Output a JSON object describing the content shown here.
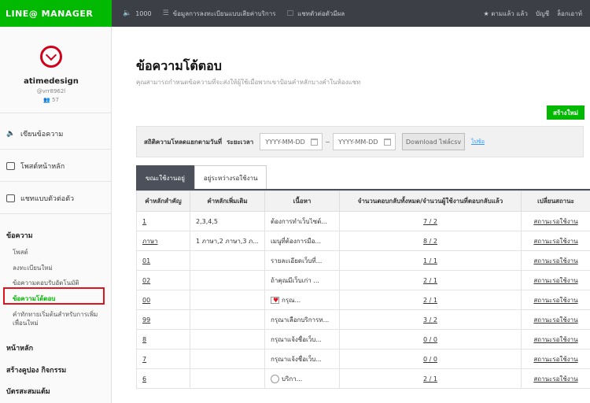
{
  "app": {
    "logo": "LINE@ MANAGER"
  },
  "topbar": {
    "item1": "1000",
    "item2": "ข้อมูลการลงทะเบียนแบบเสียค่าบริการ",
    "item3": "แชทตัวต่อตัวมีผล",
    "right1": "★ ตามแล้ว แล้ว",
    "right2": "บัญชี",
    "right3": "ล็อกเอาท์"
  },
  "account": {
    "name": "atimedesign",
    "id": "@vrr8962l",
    "friends": "57"
  },
  "sidebar": {
    "nav": [
      "เขียนข้อความ",
      "โพสต์หน้าหลัก",
      "แชทแบบตัวต่อตัว"
    ],
    "section_message": "ข้อความ",
    "sub_items": [
      "โพสต์",
      "ลงทะเบียนใหม่",
      "ข้อความตอบรับอัตโนมัติ",
      "ข้อความโต้ตอบ",
      "คำทักทายเริ่มต้นสำหรับการเพิ่ม",
      "เพื่อนใหม่"
    ],
    "section_home": "หน้าหลัก",
    "section_coupon": "สร้างคูปอง กิจกรรม",
    "section_card": "บัตรสะสมแต้ม"
  },
  "main": {
    "title": "ข้อความโต้ตอบ",
    "description": "คุณสามารถกำหนดข้อความที่จะส่งให้ผู้ใช้เมื่อพวกเขาป้อนคำหลักบางคำในห้องแชท",
    "create_button": "สร้างใหม่",
    "filter_label": "สถิติความโหลดแยกตามวันที่",
    "period_label": "ระยะเวลา",
    "date_placeholder_start": "YYYY-MM-DD",
    "date_placeholder_end": "YYYY-MM-DD",
    "tilde": "~",
    "download_button": "Download ไฟล์csv",
    "help_link": "ไปซ้อ",
    "tabs": [
      "ขณะใช้งานอยู่",
      "อยู่ระหว่างรอใช้งาน"
    ]
  },
  "table": {
    "headers": [
      "คำหลักสำคัญ",
      "คำหลักเพิ่มเติม",
      "เนื้อหา",
      "จำนวนตอบกลับทั้งหมด/จำนวนผู้ใช้งานที่ตอบกลับแล้ว",
      "เปลี่ยนสถานะ"
    ],
    "rows": [
      {
        "keyword": "1",
        "extra": "2,3,4,5",
        "content": "ต้องการทำเว็บไซต์...",
        "count": "7 / 2",
        "status": "สถานะรอใช้งาน",
        "emoji": ""
      },
      {
        "keyword": "ภาษา",
        "extra": "1 ภาษา,2 ภาษา,3 ภ...",
        "content": "เมนูที่ต้องการมือ...",
        "count": "8 / 2",
        "status": "สถานะรอใช้งาน",
        "emoji": ""
      },
      {
        "keyword": "01",
        "extra": "",
        "content": "รายละเอียดเว็บที่...",
        "count": "1 / 1",
        "status": "สถานะรอใช้งาน",
        "emoji": ""
      },
      {
        "keyword": "02",
        "extra": "",
        "content": "ถ้าคุณมีเว็บเก่า ...",
        "count": "2 / 1",
        "status": "สถานะรอใช้งาน",
        "emoji": ""
      },
      {
        "keyword": "00",
        "extra": "",
        "content": "กรุณ...",
        "count": "2 / 1",
        "status": "สถานะรอใช้งาน",
        "emoji": "heart"
      },
      {
        "keyword": "99",
        "extra": "",
        "content": "กรุณาเลือกบริการท...",
        "count": "3 / 2",
        "status": "สถานะรอใช้งาน",
        "emoji": ""
      },
      {
        "keyword": "8",
        "extra": "",
        "content": "กรุณาแจ้งชื่อเว็บ...",
        "count": "0 / 0",
        "status": "สถานะรอใช้งาน",
        "emoji": ""
      },
      {
        "keyword": "7",
        "extra": "",
        "content": "กรุณาแจ้งชื่อเว็บ...",
        "count": "0 / 0",
        "status": "สถานะรอใช้งาน",
        "emoji": ""
      },
      {
        "keyword": "6",
        "extra": "",
        "content": "บริกา...",
        "count": "2 / 1",
        "status": "สถานะรอใช้งาน",
        "emoji": "face"
      }
    ]
  }
}
